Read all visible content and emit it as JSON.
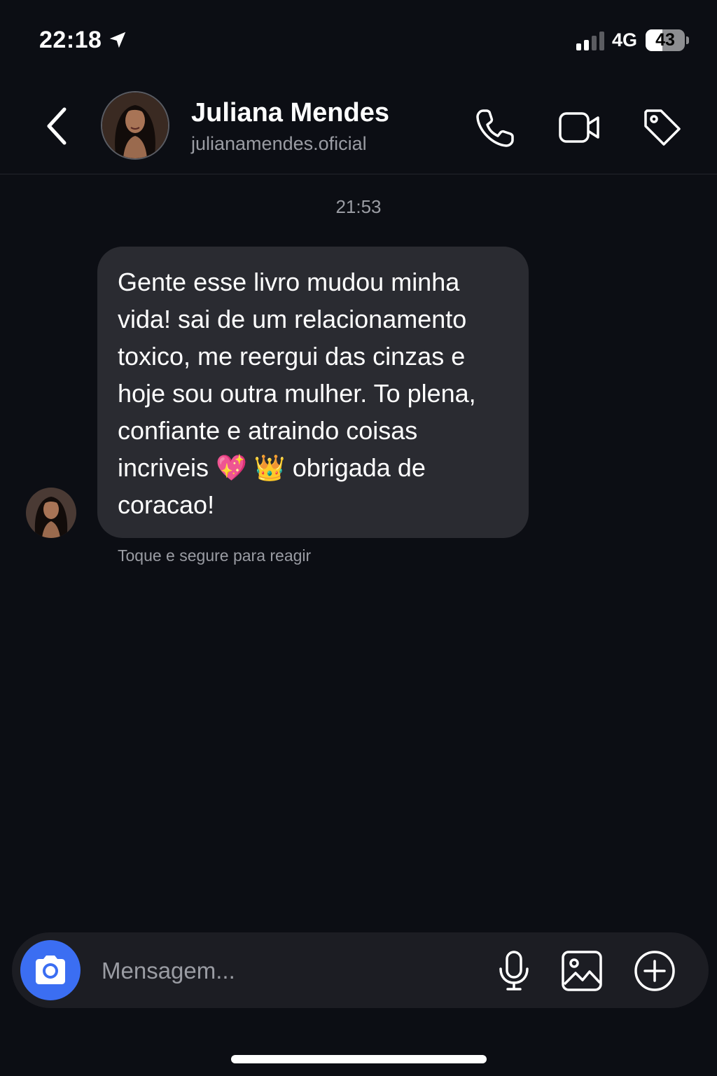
{
  "status_bar": {
    "time": "22:18",
    "network": "4G",
    "battery_level": "43",
    "signal_bars_active": 2,
    "signal_bars_total": 4
  },
  "header": {
    "contact_name": "Juliana Mendes",
    "contact_handle": "julianamendes.oficial",
    "icons": [
      "back-icon",
      "phone-icon",
      "video-icon",
      "tag-icon"
    ]
  },
  "chat": {
    "timestamp": "21:53",
    "message": {
      "lines": [
        "Gente esse livro mudou minha",
        "vida! sai de um relacionamento",
        "toxico, me reergui das cinzas e",
        "hoje sou outra mulher. To plena,",
        "confiante e atraindo coisas"
      ],
      "line6_before": "incriveis ",
      "emoji_heart": "💖",
      "emoji_crown": "👑",
      "line6_after": " obrigada de",
      "line7": "coracao!"
    },
    "react_hint": "Toque e segure para reagir"
  },
  "composer": {
    "placeholder": "Mensagem...",
    "value": "",
    "icons": [
      "camera-icon",
      "microphone-icon",
      "gallery-icon",
      "add-icon"
    ]
  },
  "colors": {
    "background": "#0c0e14",
    "bubble": "#2a2b31",
    "accent_blue": "#3b6ef2",
    "muted_text": "#9a9ca3"
  }
}
